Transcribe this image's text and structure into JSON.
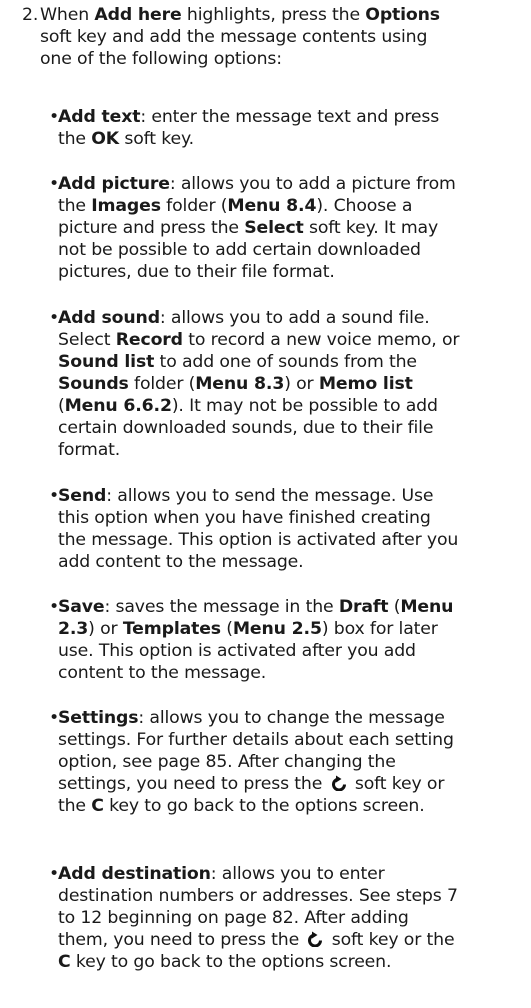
{
  "step_number": "2.",
  "intro": [
    "When ",
    "Add here",
    " highlights, press the ",
    "Options",
    "soft key and add the message contents using",
    "one of the following options:"
  ],
  "bullet": "•",
  "options": {
    "add_text": {
      "term": "Add text",
      "l1": ": enter the message text and press",
      "l2a": "the ",
      "l2b": "OK",
      "l2c": " soft key."
    },
    "add_picture": {
      "term": "Add picture",
      "l1": ": allows you to add a picture from",
      "l2a": "the ",
      "l2b": "Images",
      "l2c": " folder (",
      "l2d": "Menu 8.4",
      "l2e": "). Choose a",
      "l3a": "picture and press the ",
      "l3b": "Select",
      "l3c": " soft key. It may",
      "l4": "not be possible to add certain downloaded",
      "l5": "pictures, due to their file format."
    },
    "add_sound": {
      "term": "Add sound",
      "l1": ": allows you to add a sound file.",
      "l2a": "Select ",
      "l2b": "Record",
      "l2c": " to record a new voice memo, or",
      "l3a": "Sound list",
      "l3b": " to add one of sounds from the",
      "l4a": "Sounds",
      "l4b": " folder (",
      "l4c": "Menu 8.3",
      "l4d": ") or ",
      "l4e": "Memo list",
      "l5a": "(",
      "l5b": "Menu 6.6.2",
      "l5c": "). It may not be possible to add",
      "l6": "certain downloaded sounds, due to their file",
      "l7": "format."
    },
    "send": {
      "term": "Send",
      "l1": ": allows you to send the message. Use",
      "l2": "this option when you have finished creating",
      "l3": "the message. This option is activated after you",
      "l4": "add content to the message."
    },
    "save": {
      "term": "Save",
      "l1a": ": saves the message in the ",
      "l1b": "Draft",
      "l1c": " (",
      "l1d": "Menu",
      "l2a": "2.3",
      "l2b": ") or ",
      "l2c": "Templates",
      "l2d": " (",
      "l2e": "Menu 2.5",
      "l2f": ") box for later",
      "l3": "use. This option is activated after you add",
      "l4": "content to the message."
    },
    "settings": {
      "term": "Settings",
      "l1": ": allows you to change the message",
      "l2": "settings. For further details about each setting",
      "l3": "option, see page 85. After changing the",
      "l4a": "settings, you need to press the ",
      "l4b": " soft key or",
      "l5a": "the ",
      "l5b": "C",
      "l5c": " key to go back to the options screen."
    },
    "add_destination": {
      "term": "Add destination",
      "l1": ": allows you to enter",
      "l2": "destination numbers or addresses. See steps 7",
      "l3": "to 12 beginning on page 82. After adding",
      "l4a": "them, you need to press the ",
      "l4b": " soft key or the",
      "l5a": "C",
      "l5b": " key to go back to the options screen."
    }
  },
  "icons": {
    "back": "back-arrow-icon"
  }
}
